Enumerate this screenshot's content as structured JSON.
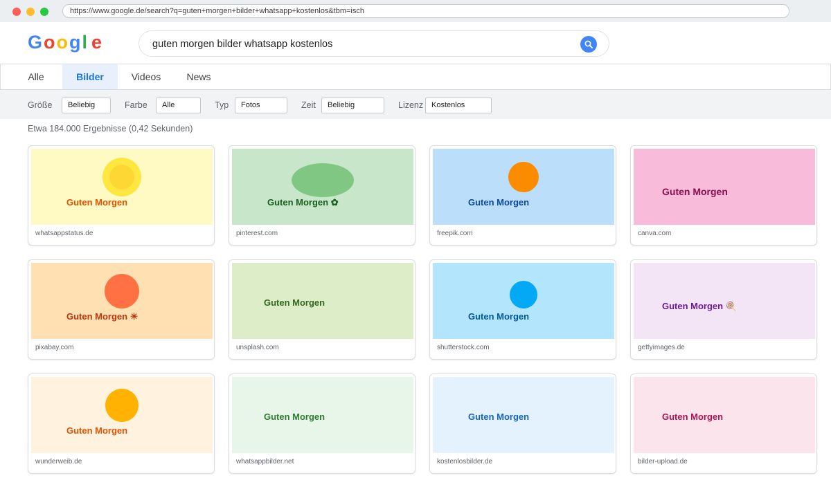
{
  "browser": {
    "url": "https://www.google.de/search?q=guten+morgen+bilder+whatsapp+kostenlos&tbm=isch"
  },
  "logo": [
    "G",
    "o",
    "o",
    "g",
    "l",
    "e"
  ],
  "search": {
    "query": "guten morgen bilder whatsapp kostenlos"
  },
  "tabs": [
    {
      "label": "Alle"
    },
    {
      "label": "Bilder"
    },
    {
      "label": "Videos"
    },
    {
      "label": "News"
    }
  ],
  "filters": [
    {
      "label": "Größe",
      "value": "Beliebig"
    },
    {
      "label": "Farbe",
      "value": "Alle"
    },
    {
      "label": "Typ",
      "value": "Fotos"
    },
    {
      "label": "Zeit",
      "value": "Beliebig"
    },
    {
      "label": "Lizenz",
      "value": "Kostenlos"
    }
  ],
  "stats": "Etwa 184.000 Ergebnisse (0,42 Sekunden)",
  "results": [
    {
      "title": "Guten Morgen",
      "source": "whatsappstatus.de"
    },
    {
      "title": "Guten Morgen ✿",
      "source": "pinterest.com"
    },
    {
      "title": "Guten Morgen",
      "source": "freepik.com"
    },
    {
      "title": "Guten Morgen",
      "source": "canva.com"
    },
    {
      "title": "Guten Morgen ☀",
      "source": "pixabay.com"
    },
    {
      "title": "Guten Morgen",
      "source": "unsplash.com"
    },
    {
      "title": "Guten Morgen",
      "source": "shutterstock.com"
    },
    {
      "title": "Guten Morgen 🍭",
      "source": "gettyimages.de"
    },
    {
      "title": "Guten Morgen",
      "source": "wunderweib.de"
    },
    {
      "title": "Guten Morgen",
      "source": "whatsappbilder.net"
    },
    {
      "title": "Guten Morgen",
      "source": "kostenlosbilder.de"
    },
    {
      "title": "Guten Morgen",
      "source": "bilder-upload.de"
    }
  ]
}
